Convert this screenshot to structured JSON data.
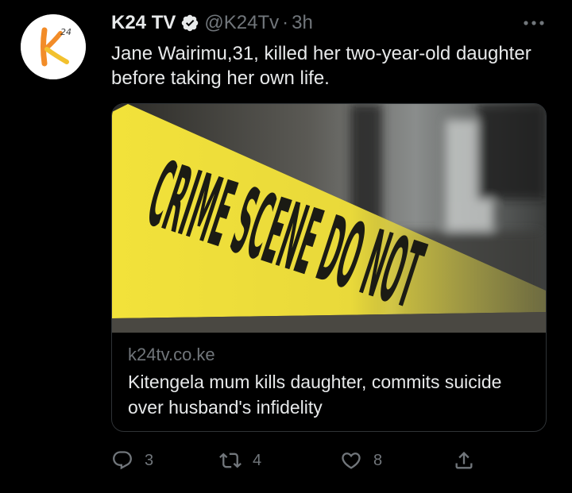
{
  "tweet": {
    "author_name": "K24 TV",
    "author_handle": "@K24Tv",
    "separator": "·",
    "time": "3h",
    "verified": true,
    "avatar_logo_text": "24",
    "text": "Jane Wairimu,31, killed her two-year-old daughter before taking her own life."
  },
  "card": {
    "image_alt": "CRIME SCENE DO NOT CROSS",
    "domain": "k24tv.co.ke",
    "title": "Kitengela mum kills daughter, commits suicide over husband's infidelity"
  },
  "actions": {
    "replies": "3",
    "retweets": "4",
    "likes": "8"
  },
  "colors": {
    "background": "#000000",
    "text_primary": "#e7e9ea",
    "text_secondary": "#71767b",
    "verified": "#1d9bf0",
    "logo_orange": "#f28c28",
    "tape_yellow": "#f2e23a"
  },
  "icons": [
    "verified-badge-icon",
    "more-icon",
    "reply-icon",
    "retweet-icon",
    "like-icon",
    "share-icon"
  ]
}
